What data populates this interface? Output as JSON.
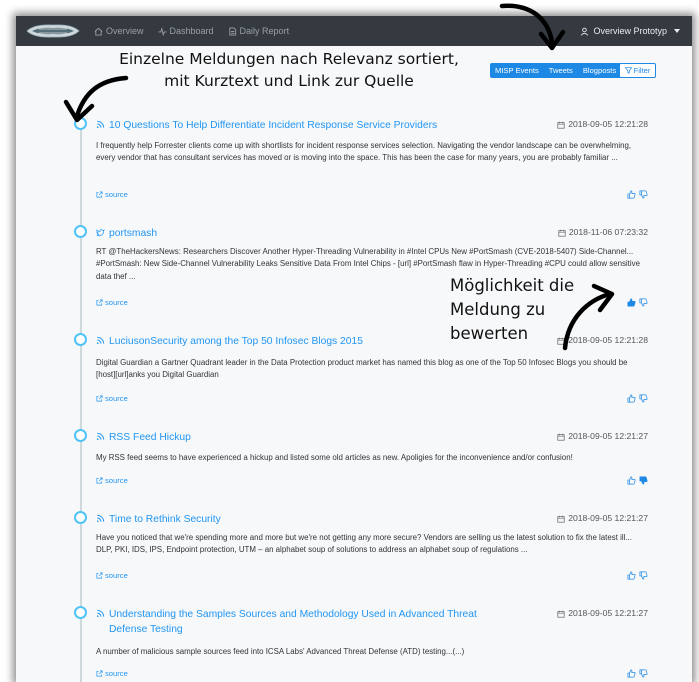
{
  "navbar": {
    "links": [
      {
        "icon": "home-icon",
        "label": "Overview"
      },
      {
        "icon": "pulse-icon",
        "label": "Dashboard"
      },
      {
        "icon": "document-icon",
        "label": "Daily Report"
      }
    ],
    "user_label": "Overview Prototyp"
  },
  "annotations": {
    "top_line1": "Einzelne Meldungen nach Relevanz sortiert,",
    "top_line2": "mit Kurztext und Link zur Quelle",
    "side_line1": "Möglichkeit die",
    "side_line2": "Meldung zu",
    "side_line3": "bewerten"
  },
  "filters": {
    "segments": [
      "MISP Events",
      "Tweets",
      "Blogposts"
    ],
    "filter_label": "Filter"
  },
  "colors": {
    "accent": "#2196f3",
    "navbar": "#343a40",
    "timeline_dot": "#4fc3f7"
  },
  "items": [
    {
      "type": "rss",
      "title": "10 Questions To Help Differentiate Incident Response Service Providers",
      "title2": "",
      "date": "2018-09-05 12:21:28",
      "text": "I frequently help Forrester clients come up with shortlists for incident response services selection. Navigating the vendor landscape can be overwhelming, every vendor that has consultant services has moved or is moving into the space. This has been the case for many years, you are probably familiar ...",
      "source": "source",
      "vote": "none"
    },
    {
      "type": "twitter",
      "title": "portsmash",
      "title2": "",
      "date": "2018-11-06 07:23:32",
      "text": "RT @TheHackersNews: Researchers Discover Another Hyper-Threading Vulnerability in #Intel CPUs New #PortSmash (CVE-2018-5407) Side-Channel... #PortSmash: New Side-Channel Vulnerability Leaks Sensitive Data From Intel Chips - [url] #PortSmash flaw in Hyper-Threading #CPU could allow sensitive data thef ...",
      "source": "source",
      "vote": "up"
    },
    {
      "type": "rss",
      "title": "LuciusonSecurity among the Top 50 Infosec Blogs 2015",
      "title2": "",
      "date": "2018-09-05 12:21:28",
      "text": "Digital Guardian a Gartner Quadrant leader in the Data Protection product market has named this blog as one of the Top 50 Infosec Blogs you should be [host][url]anks you Digital Guardian",
      "source": "source",
      "vote": "none"
    },
    {
      "type": "rss",
      "title": "RSS Feed Hickup",
      "title2": "",
      "date": "2018-09-05 12:21:27",
      "text": "My RSS feed seems to have experienced a hickup and listed some old articles as new. Apoligies for the inconvenience and/or confusion!",
      "source": "source",
      "vote": "down"
    },
    {
      "type": "rss",
      "title": "Time to Rethink Security",
      "title2": "",
      "date": "2018-09-05 12:21:27",
      "text": "Have you noticed that we're spending more and more but we're not getting any more secure? Vendors are selling us the latest solution to fix the latest ill... DLP, PKI, IDS, IPS, Endpoint protection, UTM – an alphabet soup of solutions to address an alphabet soup of regulations ...",
      "source": "source",
      "vote": "none"
    },
    {
      "type": "rss",
      "title": "Understanding the Samples Sources and Methodology Used in Advanced Threat",
      "title2": "Defense Testing",
      "date": "2018-09-05 12:21:27",
      "text": "A number of malicious sample sources feed into ICSA Labs' Advanced Threat Defense (ATD) testing...(...)",
      "source": "source",
      "vote": "none"
    }
  ]
}
